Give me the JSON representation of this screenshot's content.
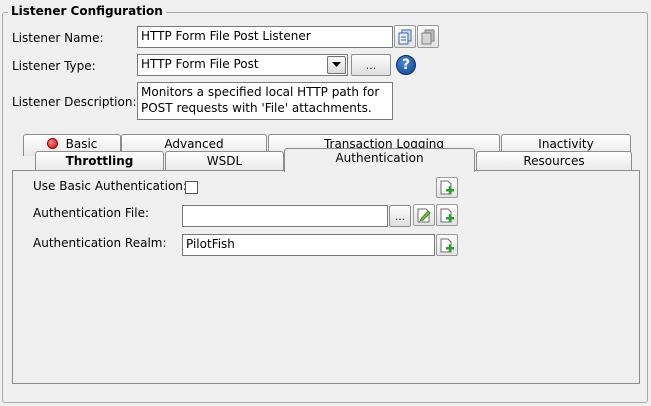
{
  "section_title": "Listener Configuration",
  "listener_name": {
    "label": "Listener Name:",
    "value": "HTTP Form File Post Listener"
  },
  "listener_type": {
    "label": "Listener Type:",
    "value": "HTTP Form File Post",
    "browse_label": "..."
  },
  "listener_description": {
    "label": "Listener Description:",
    "value": "Monitors a specified local HTTP path for POST requests with 'File' attachments."
  },
  "help_glyph": "?",
  "tabs_row1": [
    "Basic",
    "Advanced",
    "Transaction Logging",
    "Inactivity"
  ],
  "tabs_row2": [
    "Throttling",
    "WSDL",
    "Authentication",
    "Resources"
  ],
  "selected_tab": "Authentication",
  "auth": {
    "basic_auth_label": "Use Basic Authentication:",
    "basic_auth_checked": false,
    "file_label": "Authentication File:",
    "file_value": "",
    "file_browse_label": "...",
    "realm_label": "Authentication Realm:",
    "realm_value": "PilotFish"
  },
  "icons": {
    "copy": "copy-icon",
    "paste": "paste-icon",
    "dropdown": "chevron-down-icon",
    "help": "help-icon",
    "status": "red-status-icon",
    "add_variable": "add-variable-icon",
    "edit": "edit-icon"
  },
  "colors": {
    "help_blue": "#1a56b0",
    "status_red": "#d60000",
    "add_green": "#2e9e2e"
  }
}
